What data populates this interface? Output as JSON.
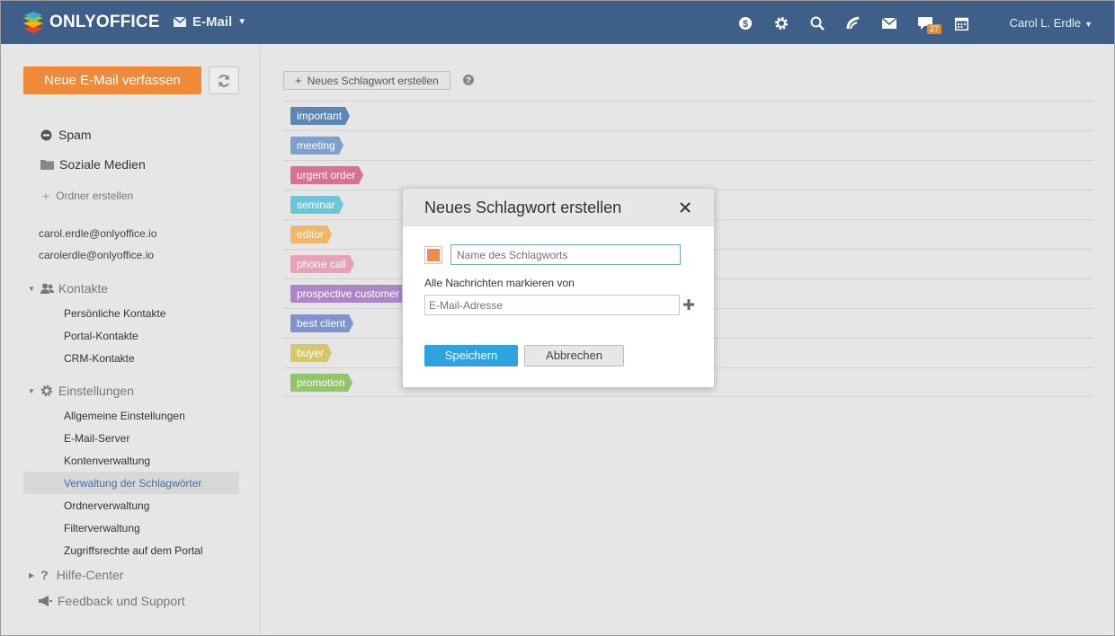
{
  "header": {
    "brand": "ONLYOFFICE",
    "module": "E-Mail",
    "icons": [
      "coin-icon",
      "gear-icon",
      "search-icon",
      "feed-icon",
      "mail-icon",
      "chat-icon",
      "calendar-icon"
    ],
    "chat_badge": "27",
    "user": "Carol L. Erdle"
  },
  "sidebar": {
    "compose_label": "Neue E-Mail verfassen",
    "folders": [
      {
        "label": "Spam",
        "icon": "minus-circle-icon"
      },
      {
        "label": "Soziale Medien",
        "icon": "folder-icon"
      }
    ],
    "create_folder": "Ordner erstellen",
    "accounts": [
      "carol.erdle@onlyoffice.io",
      "carolerdle@onlyoffice.io"
    ],
    "contacts": {
      "label": "Kontakte",
      "items": [
        "Persönliche Kontakte",
        "Portal-Kontakte",
        "CRM-Kontakte"
      ]
    },
    "settings": {
      "label": "Einstellungen",
      "items": [
        "Allgemeine Einstellungen",
        "E-Mail-Server",
        "Kontenverwaltung",
        "Verwaltung der Schlagwörter",
        "Ordnerverwaltung",
        "Filterverwaltung",
        "Zugriffsrechte auf dem Portal"
      ],
      "active": "Verwaltung der Schlagwörter"
    },
    "help_center": "Hilfe-Center",
    "feedback": "Feedback und Support"
  },
  "main": {
    "new_tag_button": "Neues Schlagwort erstellen",
    "tags": [
      {
        "label": "important",
        "color": "#5e86b5"
      },
      {
        "label": "meeting",
        "color": "#7f9fcc"
      },
      {
        "label": "urgent order",
        "color": "#d9718f"
      },
      {
        "label": "seminar",
        "color": "#6cc6d6"
      },
      {
        "label": "editor",
        "color": "#f2b66a"
      },
      {
        "label": "phone call",
        "color": "#e8a2b7"
      },
      {
        "label": "prospective customer",
        "color": "#ad86c9"
      },
      {
        "label": "best client",
        "color": "#7f93cc"
      },
      {
        "label": "buyer",
        "color": "#d4c76c"
      },
      {
        "label": "promotion",
        "color": "#92c46a"
      }
    ]
  },
  "modal": {
    "title": "Neues Schlagwort erstellen",
    "color": "#f08a55",
    "name_placeholder": "Name des Schlagworts",
    "mark_label": "Alle Nachrichten markieren von",
    "email_placeholder": "E-Mail-Adresse",
    "save": "Speichern",
    "cancel": "Abbrechen"
  }
}
